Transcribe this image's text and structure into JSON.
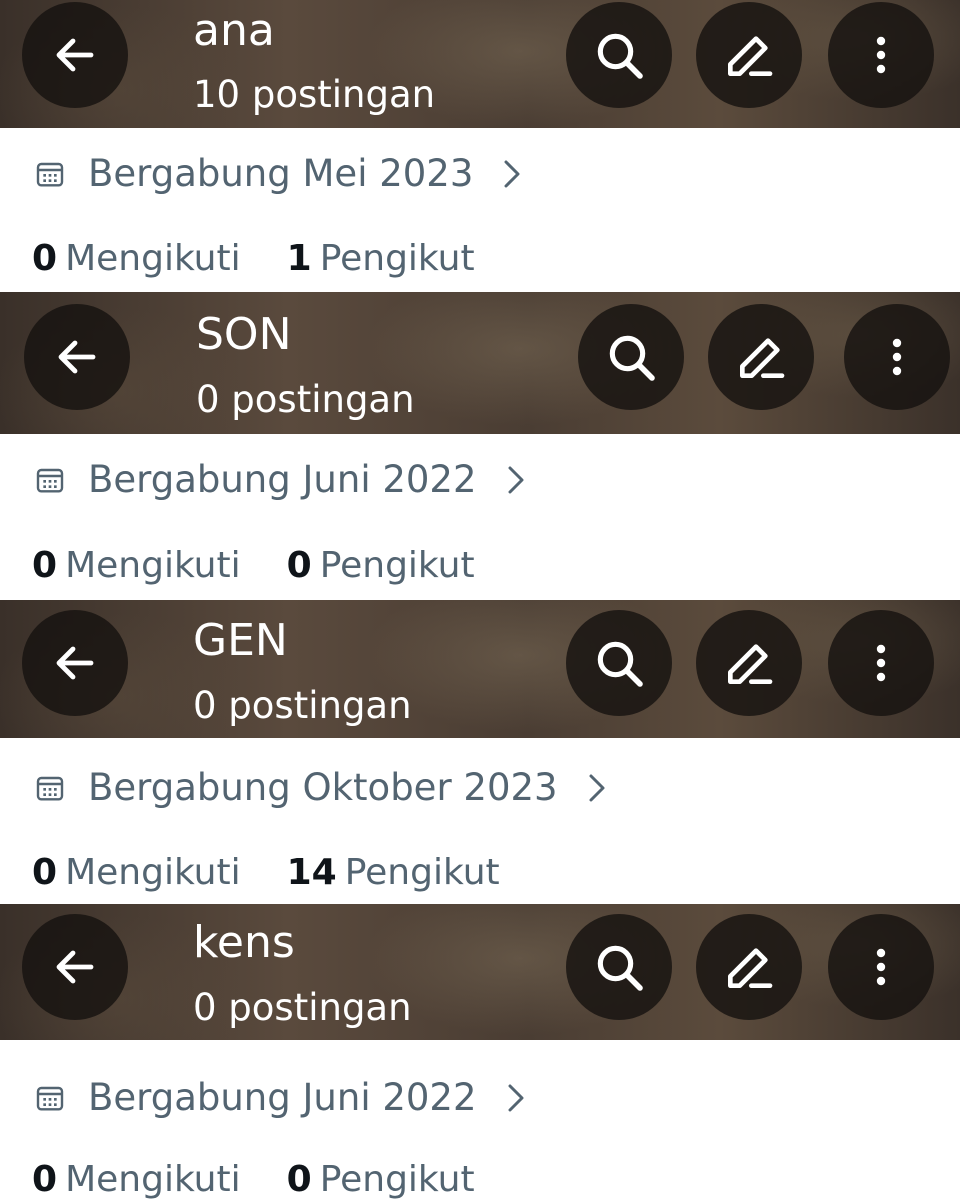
{
  "profiles": [
    {
      "name": "ana",
      "posts": "10 postingan",
      "joined": "Bergabung Mei 2023",
      "following_count": "0",
      "following_label": "Mengikuti",
      "followers_count": "1",
      "followers_label": "Pengikut"
    },
    {
      "name": "SON",
      "posts": "0 postingan",
      "joined": "Bergabung Juni 2022",
      "following_count": "0",
      "following_label": "Mengikuti",
      "followers_count": "0",
      "followers_label": "Pengikut"
    },
    {
      "name": "GEN",
      "posts": "0 postingan",
      "joined": "Bergabung Oktober 2023",
      "following_count": "0",
      "following_label": "Mengikuti",
      "followers_count": "14",
      "followers_label": "Pengikut"
    },
    {
      "name": "kens",
      "posts": "0 postingan",
      "joined": "Bergabung Juni 2022",
      "following_count": "0",
      "following_label": "Mengikuti",
      "followers_count": "0",
      "followers_label": "Pengikut"
    }
  ],
  "icons": {
    "back": "arrow-left-icon",
    "search": "search-icon",
    "edit": "pencil-icon",
    "more": "more-vertical-icon",
    "calendar": "calendar-icon",
    "chevron": "chevron-right-icon"
  },
  "colors": {
    "header_button_bg": "#161210",
    "secondary_text": "#536471",
    "primary_text": "#0f1419"
  }
}
